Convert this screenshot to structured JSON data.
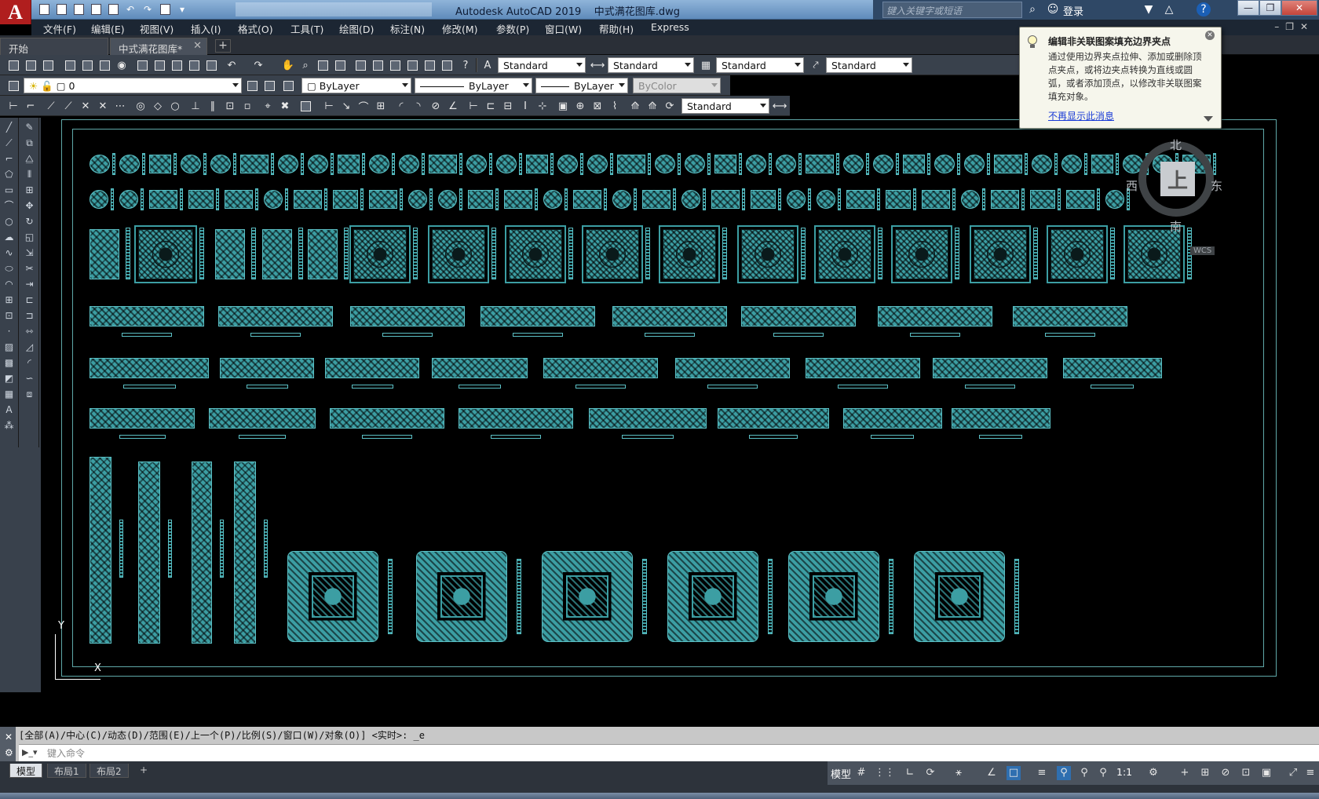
{
  "window": {
    "app_title": "Autodesk AutoCAD 2019",
    "doc_title": "中式满花图库.dwg",
    "search_placeholder": "键入关键字或短语",
    "login_label": "登录"
  },
  "menu": [
    "文件(F)",
    "编辑(E)",
    "视图(V)",
    "插入(I)",
    "格式(O)",
    "工具(T)",
    "绘图(D)",
    "标注(N)",
    "修改(M)",
    "参数(P)",
    "窗口(W)",
    "帮助(H)",
    "Express"
  ],
  "tabs": {
    "start": "开始",
    "active": "中式满花图库*",
    "add": "+"
  },
  "toolbar": {
    "text_style": "Standard",
    "dim_style": "Standard",
    "table_style": "Standard",
    "mleader_style": "Standard",
    "dim_style_2": "Standard"
  },
  "layers": {
    "current_layer": "0",
    "color": "ByLayer",
    "linetype": "ByLayer",
    "lineweight": "ByLayer",
    "plot_style": "ByColor"
  },
  "notification": {
    "title": "编辑非关联图案填充边界夹点",
    "body": "通过使用边界夹点拉伸、添加或删除顶点夹点，或将边夹点转换为直线或圆弧，或者添加顶点，以修改非关联图案填充对象。",
    "link": "不再显示此消息"
  },
  "viewcube": {
    "north": "北",
    "south": "南",
    "east": "东",
    "west": "西",
    "face": "上",
    "wcs": "WCS"
  },
  "ucs": {
    "y_label": "Y",
    "x_label": "X"
  },
  "command": {
    "history": "[全部(A)/中心(C)/动态(D)/范围(E)/上一个(P)/比例(S)/窗口(W)/对象(O)] <实时>: _e",
    "placeholder": "键入命令"
  },
  "status": {
    "layout_tabs": [
      "模型",
      "布局1",
      "布局2"
    ],
    "add_tab": "+",
    "model_label": "模型",
    "scale": "1:1"
  },
  "colors": {
    "pattern": "#3c9ea3",
    "frame": "#5fa8a8",
    "title_bar": "#6f97c4"
  }
}
